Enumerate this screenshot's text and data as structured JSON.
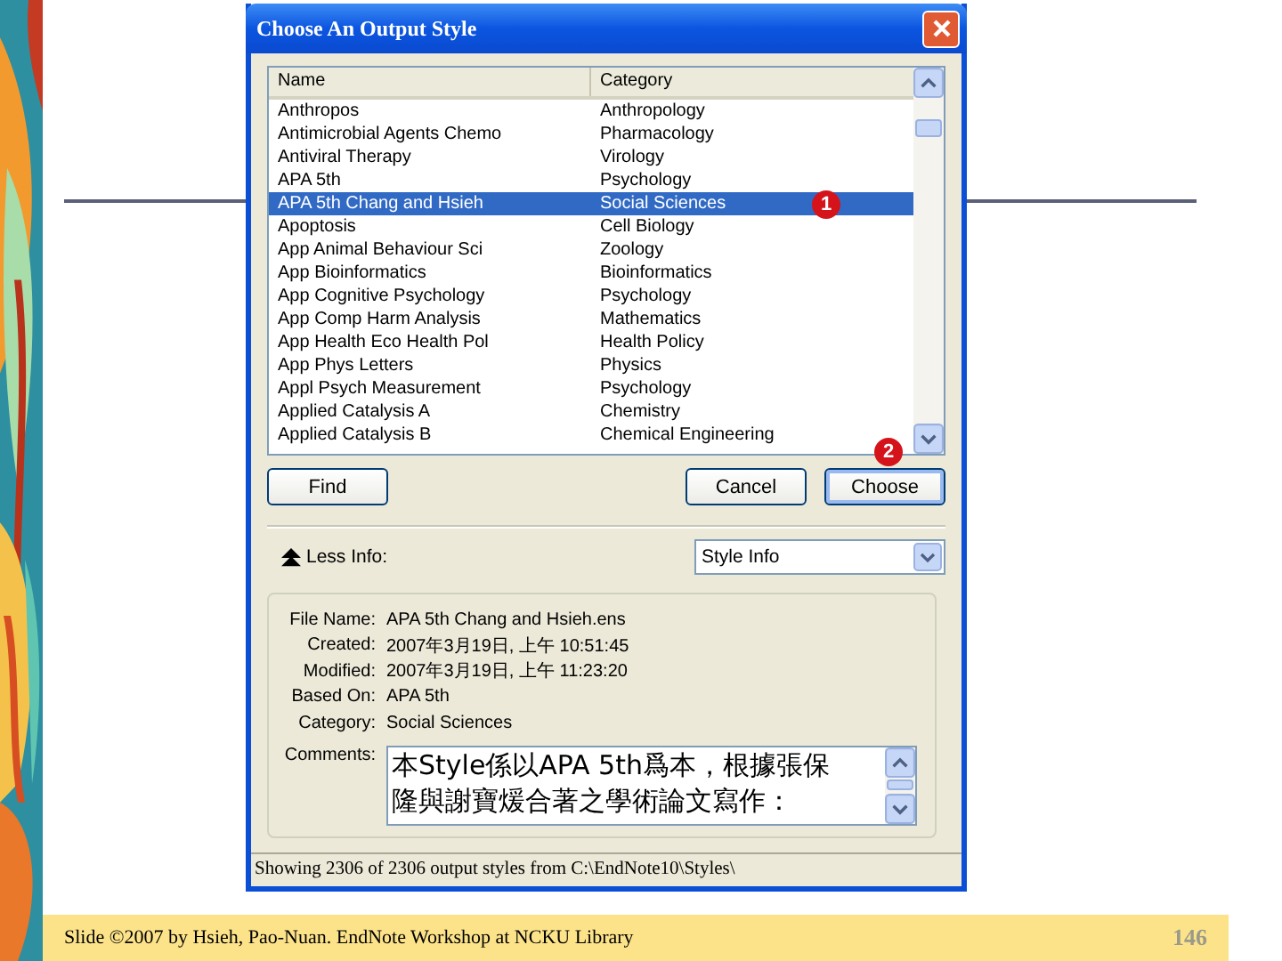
{
  "slide": {
    "footer": "Slide ©2007  by Hsieh, Pao-Nuan.  EndNote Workshop at NCKU Library",
    "page_number": "146"
  },
  "dialog": {
    "title": "Choose An Output Style",
    "columns": [
      "Name",
      "Category"
    ],
    "rows": [
      {
        "name": "Anthropos",
        "category": "Anthropology",
        "selected": false
      },
      {
        "name": "Antimicrobial Agents Chemo",
        "category": "Pharmacology",
        "selected": false
      },
      {
        "name": "Antiviral Therapy",
        "category": "Virology",
        "selected": false
      },
      {
        "name": "APA 5th",
        "category": "Psychology",
        "selected": false
      },
      {
        "name": "APA 5th Chang and Hsieh",
        "category": "Social Sciences",
        "selected": true
      },
      {
        "name": "Apoptosis",
        "category": "Cell Biology",
        "selected": false
      },
      {
        "name": "App Animal Behaviour Sci",
        "category": "Zoology",
        "selected": false
      },
      {
        "name": "App Bioinformatics",
        "category": "Bioinformatics",
        "selected": false
      },
      {
        "name": "App Cognitive Psychology",
        "category": "Psychology",
        "selected": false
      },
      {
        "name": "App Comp Harm Analysis",
        "category": "Mathematics",
        "selected": false
      },
      {
        "name": "App Health Eco Health Pol",
        "category": "Health Policy",
        "selected": false
      },
      {
        "name": "App Phys Letters",
        "category": "Physics",
        "selected": false
      },
      {
        "name": "Appl Psych Measurement",
        "category": "Psychology",
        "selected": false
      },
      {
        "name": "Applied Catalysis A",
        "category": "Chemistry",
        "selected": false
      },
      {
        "name": "Applied Catalysis B",
        "category": "Chemical Engineering",
        "selected": false
      }
    ],
    "markers": [
      "1",
      "2"
    ],
    "buttons": {
      "find": "Find",
      "cancel": "Cancel",
      "choose": "Choose"
    },
    "less_info": "Less Info:",
    "info_select": "Style Info",
    "info": [
      {
        "label": "File Name:",
        "value": "APA 5th Chang and Hsieh.ens"
      },
      {
        "label": "Created:",
        "value": "2007年3月19日, 上午 10:51:45"
      },
      {
        "label": "Modified:",
        "value": "2007年3月19日, 上午 11:23:20"
      },
      {
        "label": "Based On:",
        "value": "APA 5th"
      },
      {
        "label": "Category:",
        "value": "Social Sciences"
      }
    ],
    "comments_label": "Comments:",
    "comments": [
      "本Style係以APA 5th爲本，根據張保",
      "隆與謝寶煖合著之學術論文寫作："
    ],
    "status": "Showing 2306 of 2306 output styles from C:\\EndNote10\\Styles\\"
  }
}
